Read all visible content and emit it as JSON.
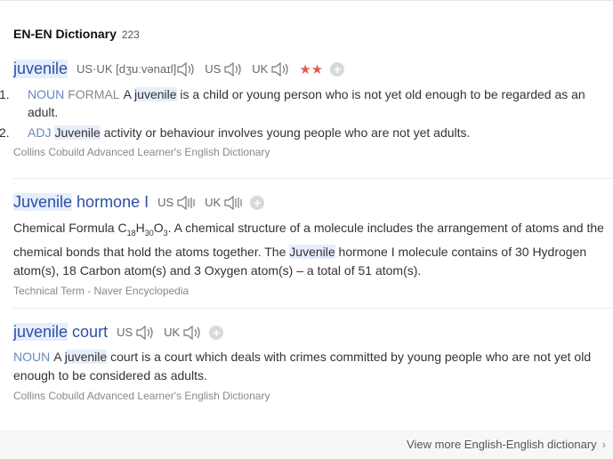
{
  "section": {
    "title": "EN-EN Dictionary",
    "count": "223"
  },
  "entry1": {
    "headword": "juvenile",
    "ipa_label": "US·UK [dʒuːvənaɪl]",
    "us_label": "US",
    "uk_label": "UK",
    "stars": "★★",
    "senses": [
      {
        "num": "1.",
        "pos": "NOUN",
        "tag": "FORMAL",
        "pre": "A ",
        "hl": "juvenile",
        "post": " is a child or young person who is not yet old enough to be regarded as an adult."
      },
      {
        "num": "2.",
        "pos": "ADJ",
        "hl": "Juvenile",
        "post": " activity or behaviour involves young people who are not yet adults."
      }
    ],
    "source": "Collins Cobuild Advanced Learner's English Dictionary"
  },
  "entry2": {
    "headword_hl": "Juvenile",
    "headword_rest": " hormone I",
    "us_label": "US",
    "uk_label": "UK",
    "text_a": "Chemical Formula C",
    "sub1": "18",
    "text_b": "H",
    "sub2": "30",
    "text_c": "O",
    "sub3": "3",
    "text_d": ". A chemical structure of a molecule includes the arrangement of atoms and the chemical bonds that hold the atoms together. The ",
    "hl": "Juvenile",
    "text_e": " hormone I molecule contains of 30 Hydrogen atom(s), 18 Carbon atom(s) and 3 Oxygen atom(s) – a total of 51 atom(s).",
    "source": "Technical Term - Naver Encyclopedia"
  },
  "entry3": {
    "headword_hl": "juvenile",
    "headword_rest": " court",
    "us_label": "US",
    "uk_label": "UK",
    "pos": "NOUN",
    "pre": "A ",
    "hl": "juvenile",
    "post": " court is a court which deals with crimes committed by young people who are not yet old enough to be considered as adults.",
    "source": "Collins Cobuild Advanced Learner's English Dictionary"
  },
  "footer": {
    "more": "View more English-English dictionary"
  }
}
